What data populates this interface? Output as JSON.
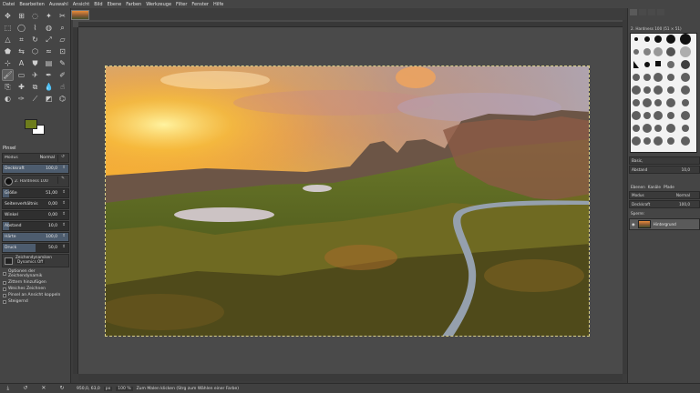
{
  "menu": [
    "Datei",
    "Bearbeiten",
    "Auswahl",
    "Ansicht",
    "Bild",
    "Ebene",
    "Farben",
    "Werkzeuge",
    "Filter",
    "Fenster",
    "Hilfe"
  ],
  "colors": {
    "foreground": "#6e7d1c",
    "background": "#ffffff",
    "selection": "#d9d08a"
  },
  "tool_options": {
    "title": "Pinsel",
    "mode_label": "Modus",
    "mode_value": "Normal",
    "opacity_label": "Deckkraft",
    "opacity_value": "100,0",
    "brush_label": "Pinsel",
    "brush_value": "2. Hardness 100",
    "size_label": "Größe",
    "size_value": "51,00",
    "aspect_label": "Seitenverhältnis",
    "aspect_value": "0,00",
    "angle_label": "Winkel",
    "angle_value": "0,00",
    "spacing_label": "Abstand",
    "spacing_value": "10,0",
    "hardness_label": "Härte",
    "hardness_value": "100,0",
    "force_label": "Druck",
    "force_value": "50,0",
    "dynamics_label": "Zeichendynamiken",
    "dynamics_value": "Dynamics Off",
    "checks": [
      {
        "label": "Optionen der Zeichendynamik",
        "on": false
      },
      {
        "label": "Zittern hinzufügen",
        "on": false
      },
      {
        "label": "Weiches Zeichnen",
        "on": false
      },
      {
        "label": "Pinsel an Ansicht koppeln",
        "on": false
      },
      {
        "label": "Steigernd",
        "on": false
      }
    ]
  },
  "status": {
    "coords": "950,0, 63,0",
    "unit": "px",
    "zoom": "100 %",
    "hint": "Zum Malen klicken (Strg zum Wählen einer Farbe)"
  },
  "brushes": {
    "header": "2. Hardness 100 (51 × 51)",
    "filter": "Basic,",
    "spacing_label": "Abstand",
    "spacing_value": "10,0"
  },
  "layers": {
    "tabs": [
      "Ebenen",
      "Kanäle",
      "Pfade"
    ],
    "mode_label": "Modus",
    "mode_value": "Normal",
    "opacity_label": "Deckkraft",
    "opacity_value": "100,0",
    "lock_label": "Sperre:",
    "layer_name": "Hintergrund"
  }
}
